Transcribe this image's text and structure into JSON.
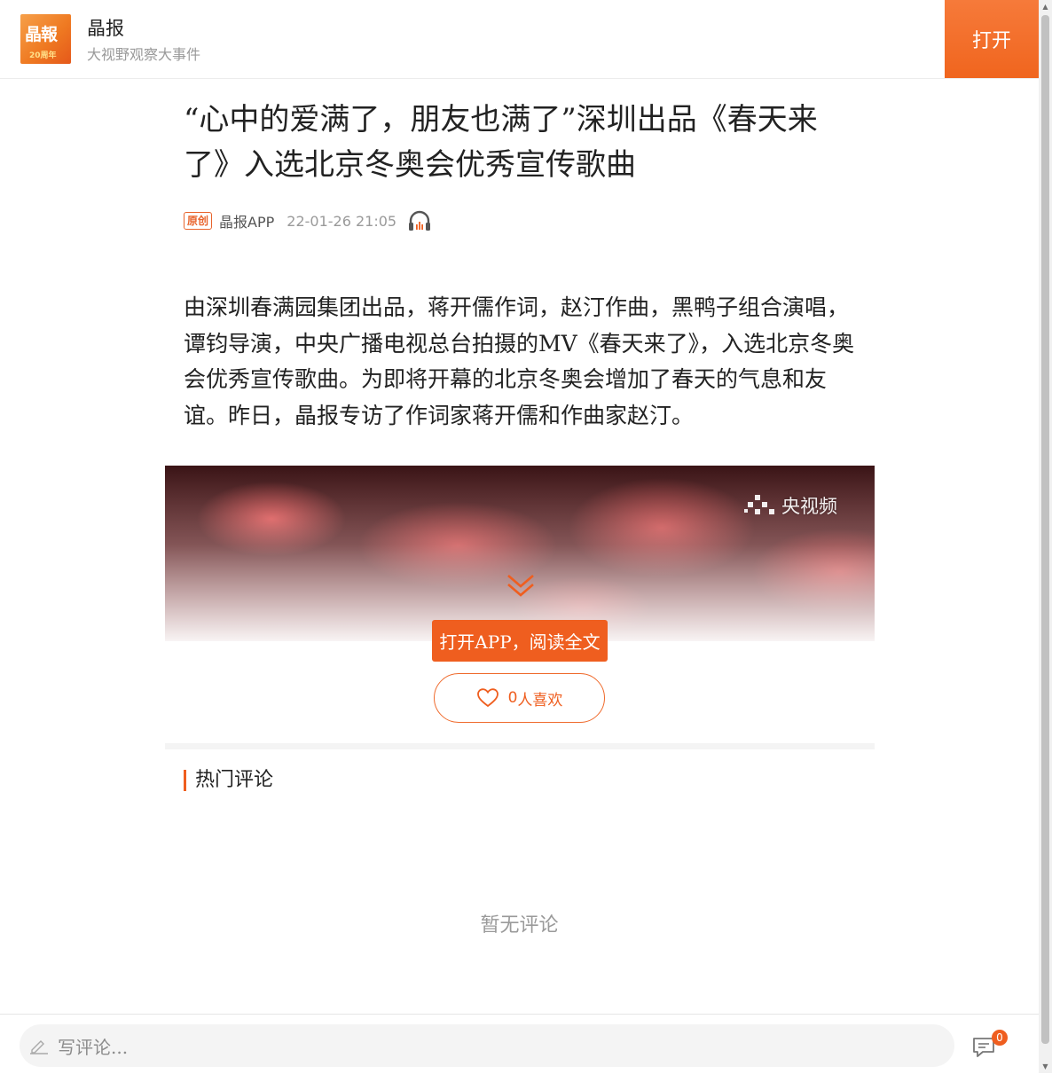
{
  "header": {
    "logo_text": "晶報",
    "logo_subtext": "20周年",
    "app_name": "晶报",
    "slogan": "大视野观察大事件",
    "open_button": "打开"
  },
  "article": {
    "title": "“心中的爱满了，朋友也满了”深圳出品《春天来了》入选北京冬奥会优秀宣传歌曲",
    "badge": "原创",
    "source": "晶报APP",
    "time": "22-01-26 21:05",
    "body": "由深圳春满园集团出品，蒋开儒作词，赵汀作曲，黑鸭子组合演唱，谭钧导演，中央广播电视总台拍摄的MV《春天来了》，入选北京冬奥会优秀宣传歌曲。为即将开幕的北京冬奥会增加了春天的气息和友谊。昨日，晶报专访了作词家蒋开儒和作曲家赵汀。"
  },
  "video": {
    "watermark": "央视频"
  },
  "actions": {
    "read_full": "打开APP，阅读全文",
    "like_count": "0",
    "like_label": "人喜欢"
  },
  "comments": {
    "section_title": "热门评论",
    "empty_text": "暂无评论"
  },
  "bottom_bar": {
    "input_placeholder": "写评论...",
    "comment_count": "0"
  },
  "colors": {
    "accent": "#ef5e1f",
    "muted_text": "#9a9a9a"
  }
}
